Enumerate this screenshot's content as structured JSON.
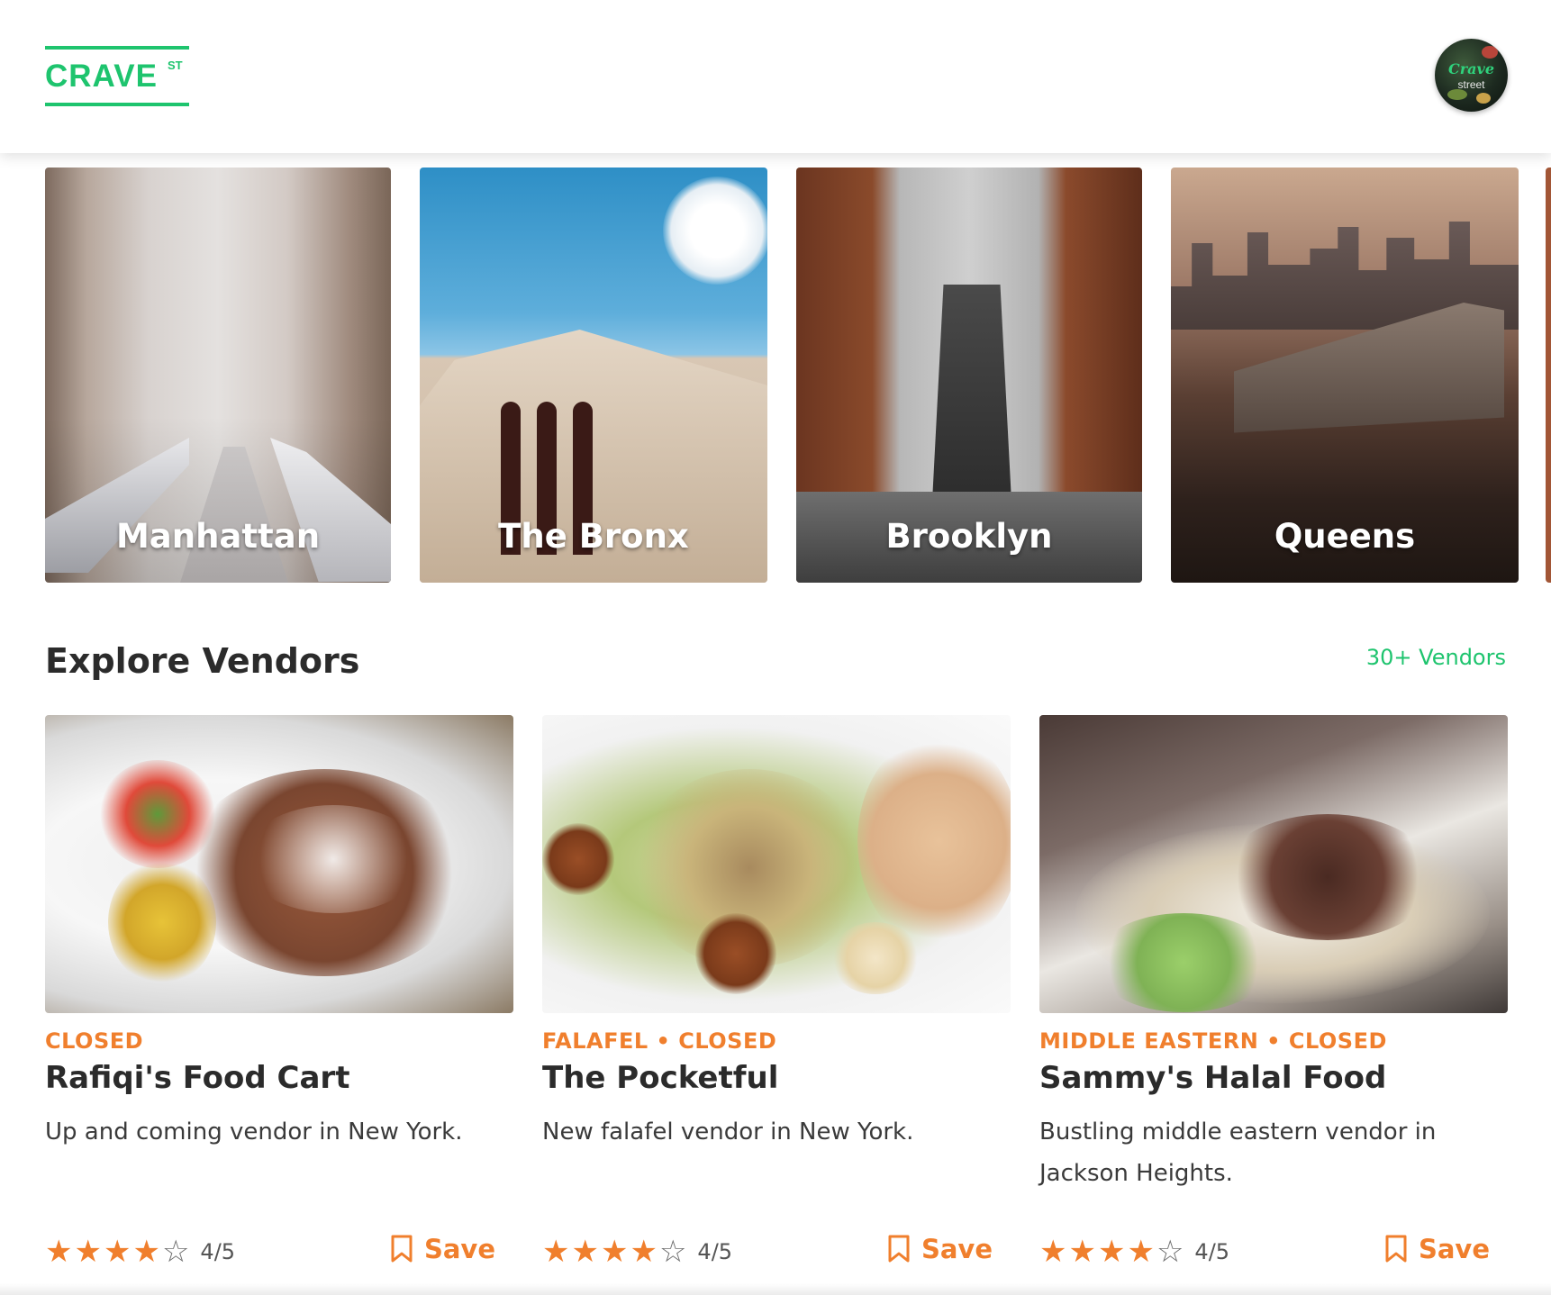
{
  "header": {
    "logo_text": "CRAVE",
    "logo_sup": "ST",
    "avatar_line1": "Crave",
    "avatar_line2": "street",
    "brand_color": "#1ec46e"
  },
  "boroughs": [
    {
      "label": "Manhattan"
    },
    {
      "label": "The Bronx"
    },
    {
      "label": "Brooklyn"
    },
    {
      "label": "Queens"
    }
  ],
  "section": {
    "title": "Explore Vendors",
    "count_link": "30+ Vendors"
  },
  "accent_color": "#f07f2d",
  "vendors": [
    {
      "meta": "CLOSED",
      "name": "Rafiqi's Food Cart",
      "description": "Up and coming vendor in New York.",
      "rating": 4,
      "rating_max": 5,
      "rating_text": "4/5",
      "save_label": "Save"
    },
    {
      "meta": "FALAFEL • CLOSED",
      "name": "The Pocketful",
      "description": "New falafel vendor in New York.",
      "rating": 4,
      "rating_max": 5,
      "rating_text": "4/5",
      "save_label": "Save"
    },
    {
      "meta": "MIDDLE EASTERN • CLOSED",
      "name": "Sammy's Halal Food",
      "description": "Bustling middle eastern vendor in Jackson Heights.",
      "rating": 4,
      "rating_max": 5,
      "rating_text": "4/5",
      "save_label": "Save"
    }
  ]
}
